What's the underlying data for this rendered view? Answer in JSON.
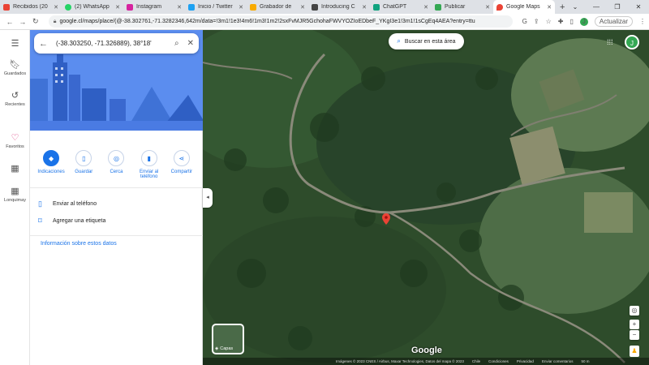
{
  "browser": {
    "tabs": [
      {
        "title": "Recibidos (20",
        "color": "#ea4335"
      },
      {
        "title": "(2) WhatsApp",
        "color": "#25d366"
      },
      {
        "title": "Instagram",
        "color": "#d6249f"
      },
      {
        "title": "Inicio / Twitter",
        "color": "#1da1f2"
      },
      {
        "title": "Grabador de",
        "color": "#f9ab00"
      },
      {
        "title": "Introducing C",
        "color": "#444444"
      },
      {
        "title": "ChatGPT",
        "color": "#10a37f"
      },
      {
        "title": "Publicar",
        "color": "#34a853"
      },
      {
        "title": "Google Maps",
        "color": "#ea4335"
      }
    ],
    "url": "google.cl/maps/place/(@-38.302761,-71.3282346,642m/data=!3m1!1e3!4m6!1m3!1m2!2sxFvMJR5GchohaFWVYOZIoEDbeF_YKgI3e1!3m1!1sCgEq4AEA?entry=ttu",
    "update_label": "Actualizar",
    "profile_letter": "J"
  },
  "rail": {
    "saved": "Guardados",
    "recent": "Recientes",
    "favorites": "Favoritos",
    "place": "Lonquimay"
  },
  "panel": {
    "search_value": "(-38.303250, -71.326889), 38°18'",
    "actions": {
      "directions": "Indicaciones",
      "save": "Guardar",
      "nearby": "Cerca",
      "send": "Enviar al teléfono",
      "share": "Compartir"
    },
    "send_to_phone": "Enviar al teléfono",
    "add_label": "Agregar una etiqueta",
    "info_link": "Información sobre estos datos"
  },
  "map": {
    "search_area": "Buscar en esta área",
    "layers": "Capas",
    "logo": "Google",
    "attribution": "Imágenes © 2023 CNES / Airbus, Maxar Technologies, Datos del mapa © 2023",
    "country": "Chile",
    "terms": "Condiciones",
    "privacy": "Privacidad",
    "feedback": "Enviar comentarios",
    "scale": "50 m",
    "avatar_letter": "J"
  }
}
